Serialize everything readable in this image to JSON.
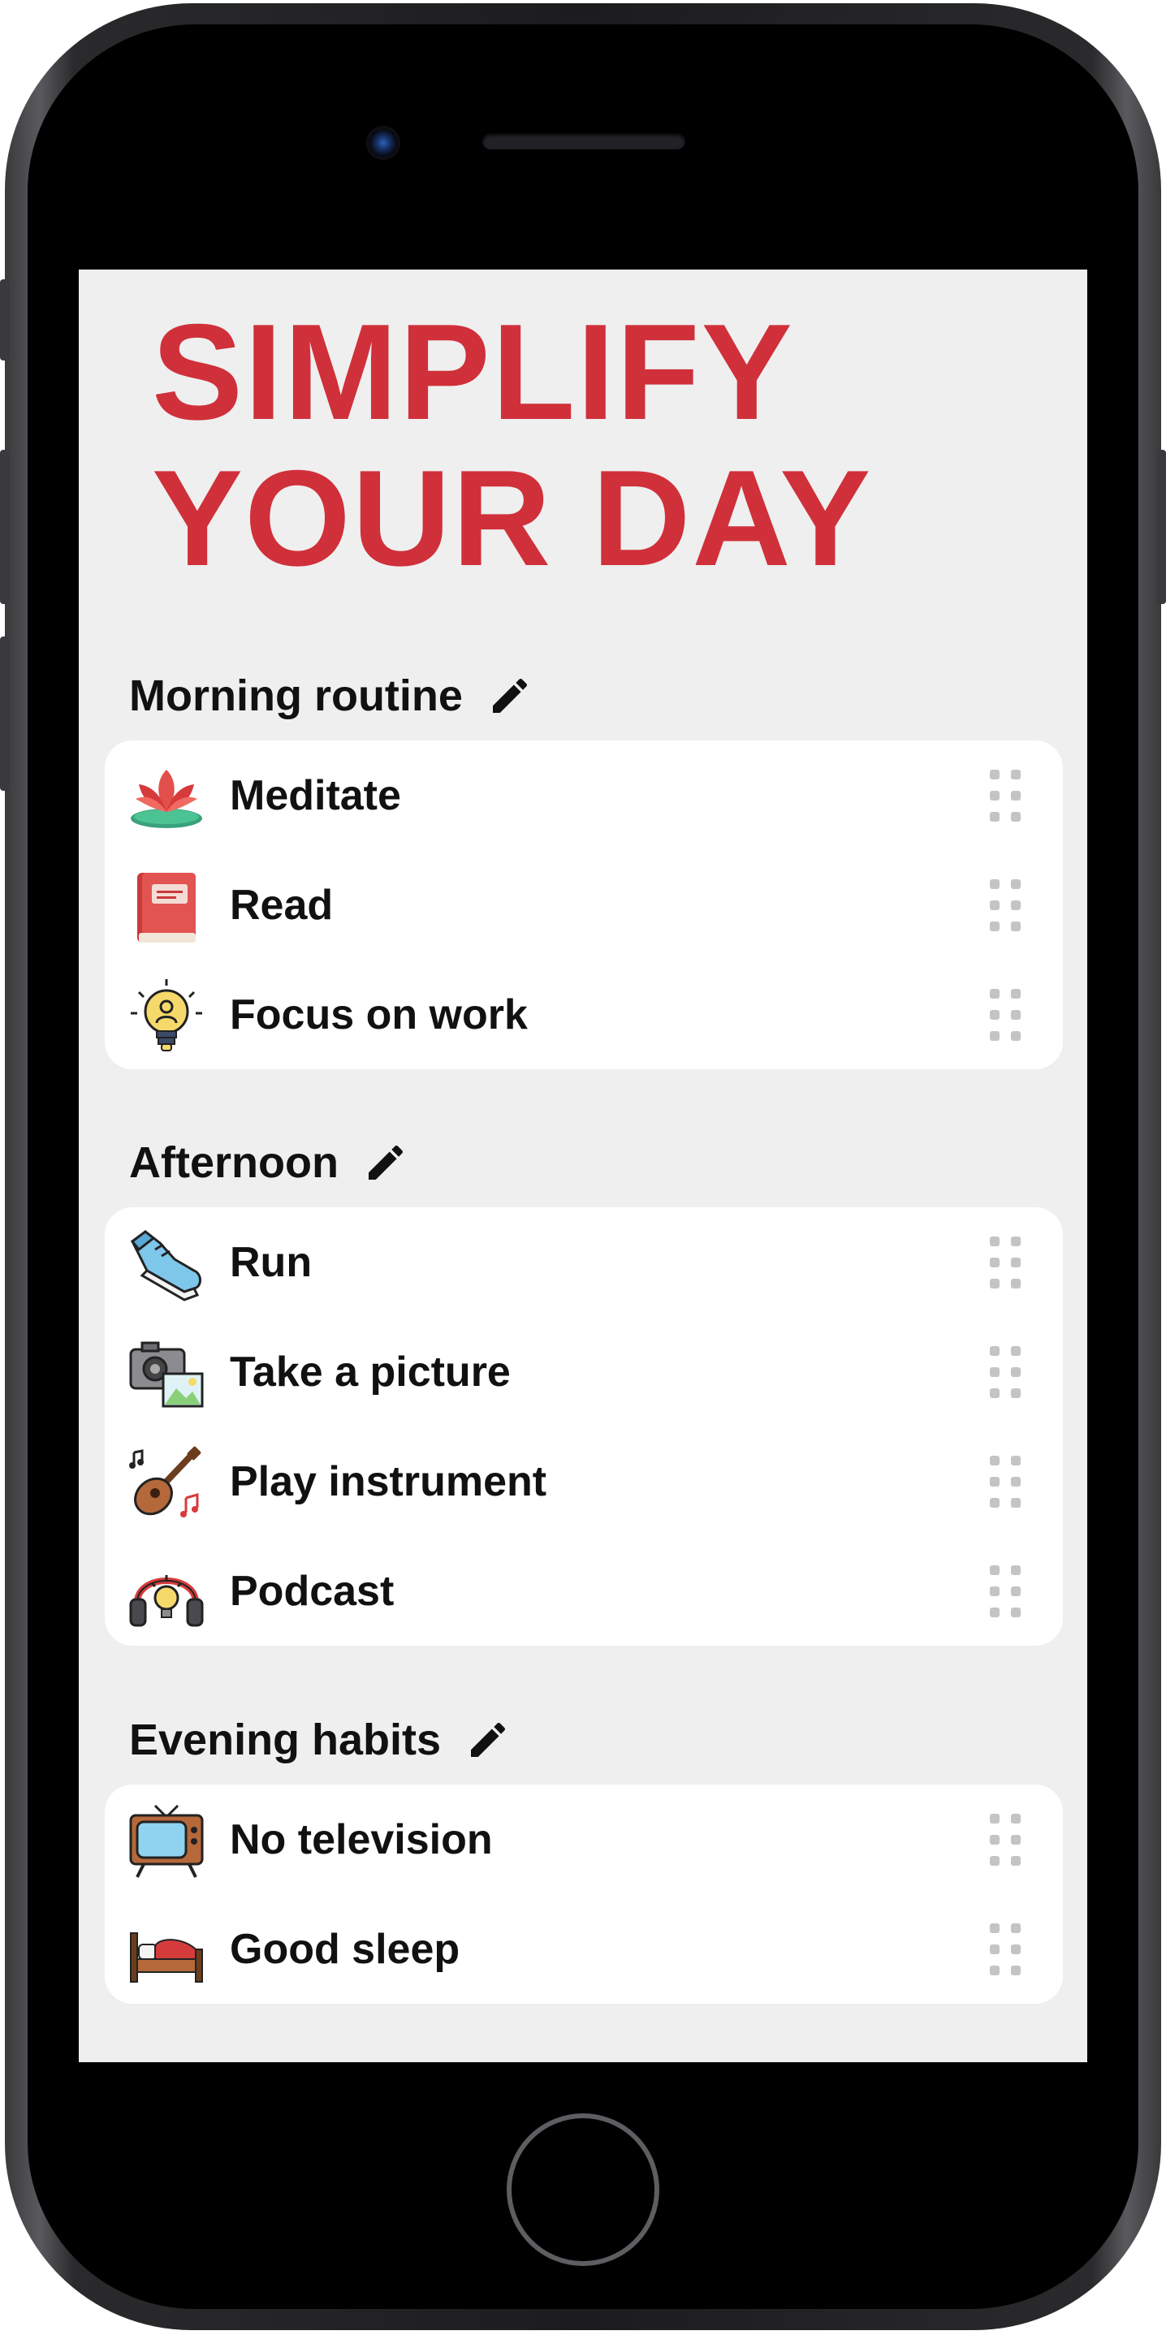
{
  "headline": {
    "line1": "SIMPLIFY",
    "line2": "YOUR DAY"
  },
  "colors": {
    "accent": "#d0303a",
    "screen_background": "#efefef",
    "card_background": "#ffffff",
    "text": "#111111",
    "handle": "#c4c4c6"
  },
  "sections": [
    {
      "title": "Morning routine",
      "edit_icon": "pencil-icon",
      "items": [
        {
          "label": "Meditate",
          "icon": "lotus-icon"
        },
        {
          "label": "Read",
          "icon": "book-icon"
        },
        {
          "label": "Focus on work",
          "icon": "lightbulb-icon"
        }
      ]
    },
    {
      "title": "Afternoon",
      "edit_icon": "pencil-icon",
      "items": [
        {
          "label": "Run",
          "icon": "sneaker-icon"
        },
        {
          "label": "Take a picture",
          "icon": "camera-icon"
        },
        {
          "label": "Play instrument",
          "icon": "guitar-icon"
        },
        {
          "label": "Podcast",
          "icon": "headphones-icon"
        }
      ]
    },
    {
      "title": "Evening habits",
      "edit_icon": "pencil-icon",
      "items": [
        {
          "label": "No television",
          "icon": "television-icon"
        },
        {
          "label": "Good sleep",
          "icon": "bed-icon"
        }
      ]
    }
  ]
}
